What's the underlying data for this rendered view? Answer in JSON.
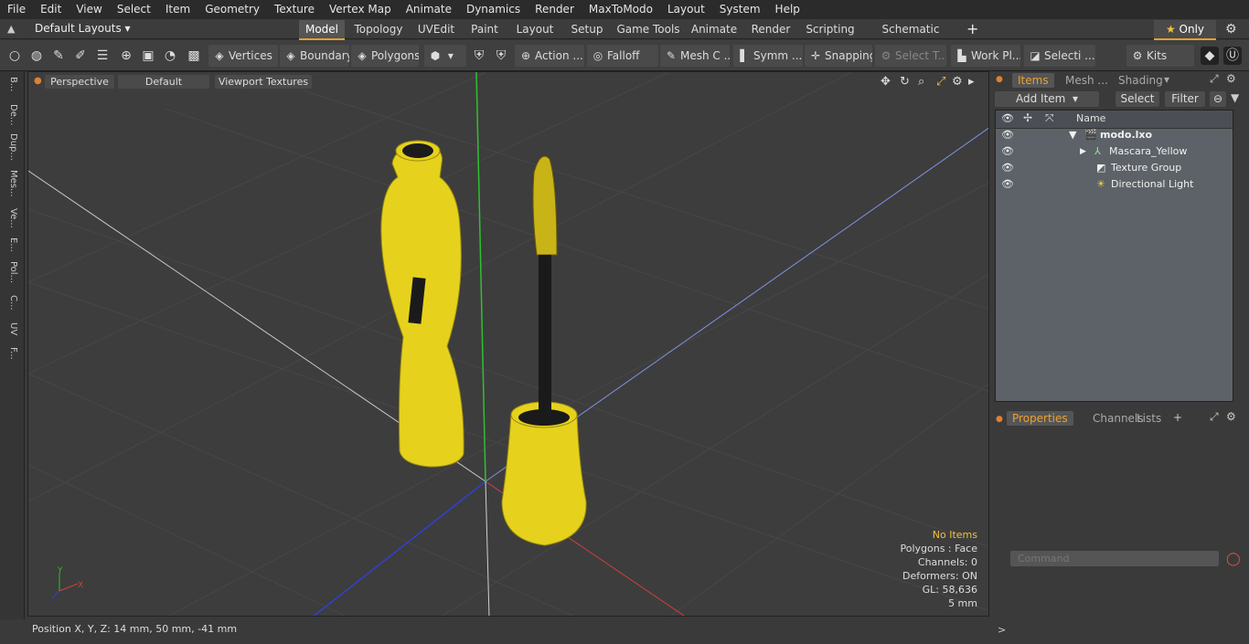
{
  "menu": [
    "File",
    "Edit",
    "View",
    "Select",
    "Item",
    "Geometry",
    "Texture",
    "Vertex Map",
    "Animate",
    "Dynamics",
    "Render",
    "MaxToModo",
    "Layout",
    "System",
    "Help"
  ],
  "layout_selector": "Default Layouts",
  "layout_tabs": [
    "Model",
    "Topology",
    "UVEdit",
    "Paint",
    "Layout",
    "Setup",
    "Game Tools",
    "Animate",
    "Render",
    "Scripting",
    "Schematic Fusion"
  ],
  "active_tab": "Model",
  "only_label": "Only",
  "toolbar": {
    "vertices": "Vertices",
    "boundary": "Boundary",
    "polygons": "Polygons",
    "action": "Action ...",
    "falloff": "Falloff",
    "mesh": "Mesh C ...",
    "symm": "Symm ...",
    "snapping": "Snapping",
    "select_t": "Select T...",
    "work_pl": "Work Pl...",
    "selecti": "Selecti ...",
    "kits": "Kits"
  },
  "left_tabs": [
    "B...",
    "De...",
    "Dup...",
    "Mes...",
    "Ve...",
    "E...",
    "Pol...",
    "C...",
    "UV",
    "F..."
  ],
  "viewport": {
    "view": "Perspective",
    "shading": "Default",
    "textures": "Viewport Textures",
    "info": {
      "no_items": "No Items",
      "polygons": "Polygons : Face",
      "channels": "Channels: 0",
      "deformers": "Deformers: ON",
      "gl": "GL: 58,636",
      "scale": "5 mm"
    }
  },
  "items_panel": {
    "tabs": [
      "Items",
      "Mesh ...",
      "Shading"
    ],
    "add_item": "Add Item",
    "select": "Select",
    "filter": "Filter",
    "column": "Name",
    "rows": [
      {
        "name": "modo.lxo"
      },
      {
        "name": "Mascara_Yellow"
      },
      {
        "name": "Texture Group"
      },
      {
        "name": "Directional Light"
      }
    ]
  },
  "properties_panel": {
    "tabs": [
      "Properties",
      "Channels",
      "Lists"
    ]
  },
  "command_placeholder": "Command",
  "status": "Position X, Y, Z:   14 mm, 50 mm, -41 mm",
  "colors": {
    "accent": "#e0a030",
    "mascara": "#e8d21e",
    "wand": "#1a1a1a"
  }
}
